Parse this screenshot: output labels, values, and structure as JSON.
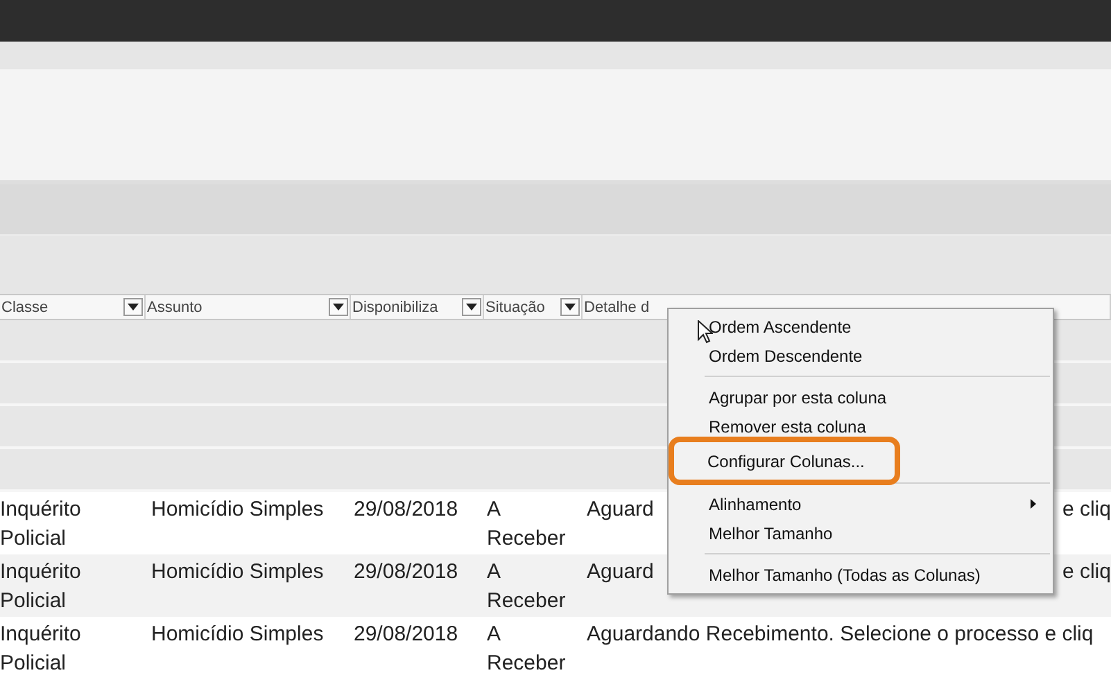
{
  "table": {
    "columns": [
      {
        "label": "Classe",
        "dropdown": true
      },
      {
        "label": "Assunto",
        "dropdown": true
      },
      {
        "label": "Disponibiliza",
        "dropdown": true
      },
      {
        "label": "Situação",
        "dropdown": true
      },
      {
        "label": "Detalhe d",
        "dropdown": false
      }
    ],
    "rows": [
      {
        "classe": "Inquérito Policial",
        "assunto": "Homicídio Simples",
        "data": "29/08/2018",
        "situacao": "A Receber",
        "detalhe": [
          "Aguard",
          "e cliq"
        ]
      },
      {
        "classe": "Inquérito Policial",
        "assunto": "Homicídio Simples",
        "data": "29/08/2018",
        "situacao": "A Receber",
        "detalhe": [
          "Aguard",
          "e cliq"
        ]
      },
      {
        "classe": "Inquérito Policial",
        "assunto": "Homicídio Simples",
        "data": "29/08/2018",
        "situacao": "A Receber",
        "detalhe": [
          "Aguardando Recebimento. Selecione o processo e cliq"
        ]
      }
    ]
  },
  "context_menu": {
    "items": [
      {
        "kind": "item",
        "label": "Ordem Ascendente",
        "highlighted": false,
        "submenu": false
      },
      {
        "kind": "item",
        "label": "Ordem Descendente",
        "highlighted": false,
        "submenu": false
      },
      {
        "kind": "separator"
      },
      {
        "kind": "item",
        "label": "Agrupar por esta coluna",
        "highlighted": false,
        "submenu": false
      },
      {
        "kind": "item",
        "label": "Remover esta coluna",
        "highlighted": false,
        "submenu": false
      },
      {
        "kind": "item",
        "label": "Configurar Colunas...",
        "highlighted": true,
        "submenu": false
      },
      {
        "kind": "separator"
      },
      {
        "kind": "item",
        "label": "Alinhamento",
        "highlighted": false,
        "submenu": true
      },
      {
        "kind": "item",
        "label": "Melhor Tamanho",
        "highlighted": false,
        "submenu": false
      },
      {
        "kind": "separator"
      },
      {
        "kind": "item",
        "label": "Melhor Tamanho (Todas as Colunas)",
        "highlighted": false,
        "submenu": false
      }
    ]
  }
}
